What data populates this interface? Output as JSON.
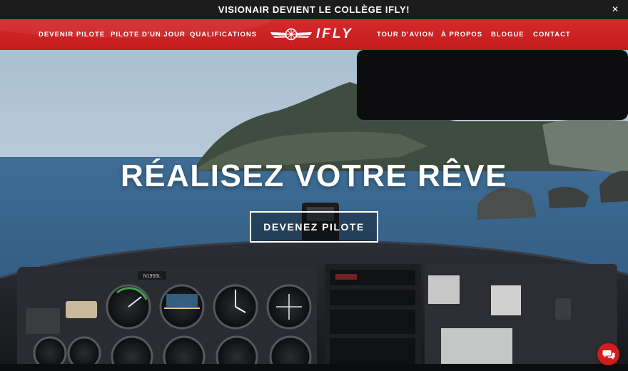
{
  "announcement": {
    "text": "VISIONAIR DEVIENT LE COLLÈGE IFLY!",
    "close_glyph": "✕"
  },
  "nav": {
    "left_items": [
      "DEVENIR PILOTE",
      "PILOTE D'UN JOUR",
      "QUALIFICATIONS"
    ],
    "right_items": [
      "TOUR D'AVION",
      "À PROPOS",
      "BLOGUE",
      "CONTACT"
    ],
    "brand": "IFLY"
  },
  "hero": {
    "headline": "RÉALISEZ VOTRE RÊVE",
    "cta_label": "DEVENEZ PILOTE"
  },
  "cockpit": {
    "tail_number": "N1955L"
  },
  "colors": {
    "brand_red": "#c8201f",
    "topbar": "#1c1c1c",
    "chat": "#d31d1d"
  },
  "icons": {
    "close": "close-icon",
    "chat": "chat-icon",
    "logo": "wings-logo-icon"
  }
}
